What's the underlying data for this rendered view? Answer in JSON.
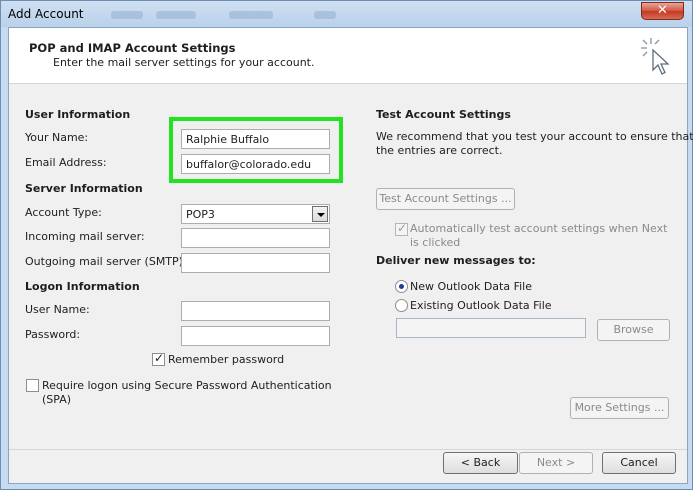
{
  "window": {
    "title": "Add Account",
    "close_glyph": "✕"
  },
  "header": {
    "title": "POP and IMAP Account Settings",
    "subtitle": "Enter the mail server settings for your account.",
    "icon": "wizard-cursor-icon"
  },
  "user_info": {
    "heading": "User Information",
    "name_label": "Your Name:",
    "name_value": "Ralphie Buffalo",
    "email_label": "Email Address:",
    "email_value": "buffalor@colorado.edu"
  },
  "server_info": {
    "heading": "Server Information",
    "account_type_label": "Account Type:",
    "account_type_value": "POP3",
    "incoming_label": "Incoming mail server:",
    "incoming_value": "",
    "outgoing_label": "Outgoing mail server (SMTP):",
    "outgoing_value": ""
  },
  "logon_info": {
    "heading": "Logon Information",
    "username_label": "User Name:",
    "username_value": "",
    "password_label": "Password:",
    "password_value": "",
    "remember_label": "Remember password",
    "remember_checked": true,
    "spa_label_1": "Require logon using Secure Password Authentication",
    "spa_label_2": "(SPA)",
    "spa_checked": false
  },
  "test_settings": {
    "heading": "Test Account Settings",
    "description_1": "We recommend that you test your account to ensure that",
    "description_2": "the entries are correct.",
    "button": "Test Account Settings ...",
    "auto_test_label_1": "Automatically test account settings when Next",
    "auto_test_label_2": "is clicked",
    "auto_test_checked": true
  },
  "deliver": {
    "heading": "Deliver new messages to:",
    "option_new": "New Outlook Data File",
    "option_existing": "Existing Outlook Data File",
    "selected": "new",
    "browse_button": "Browse"
  },
  "more_settings_button": "More Settings ...",
  "footer": {
    "back_button": "< Back",
    "next_button": "Next >",
    "cancel_button": "Cancel"
  },
  "colors": {
    "highlight": "#22e322",
    "title_bar": "#b9d1ea",
    "close_button": "#c23a22"
  }
}
